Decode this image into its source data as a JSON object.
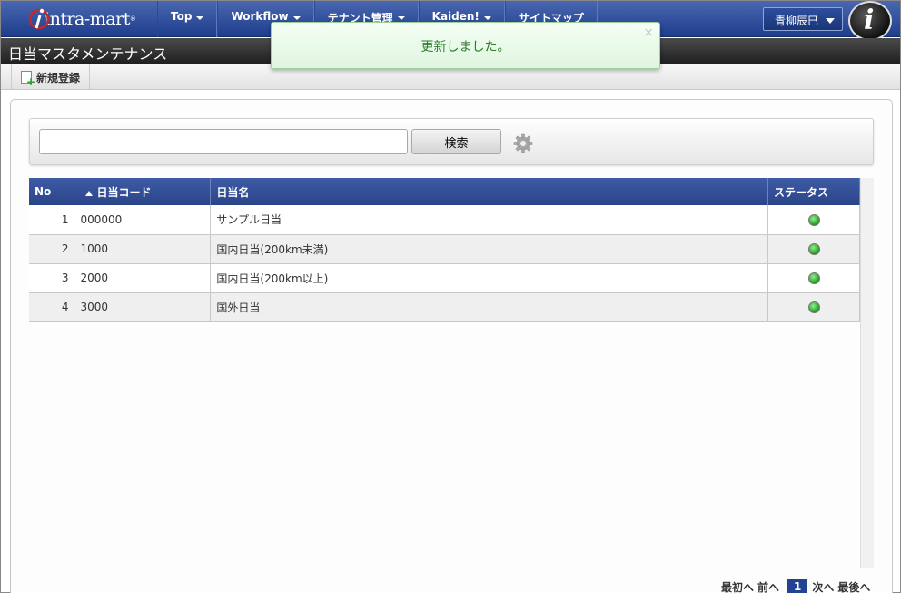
{
  "header": {
    "logo_text": "intra-mart",
    "logo_reg": "®",
    "nav": [
      {
        "label": "Top"
      },
      {
        "label": "Workflow"
      },
      {
        "label": "テナント管理"
      },
      {
        "label": "Kaiden!"
      },
      {
        "label": "サイトマップ"
      }
    ],
    "user_name": "青柳辰巳",
    "help_icon_letter": "i"
  },
  "page_title": "日当マスタメンテナンス",
  "toolbar": {
    "new_label": "新規登録"
  },
  "search": {
    "value": "",
    "placeholder": "",
    "button_label": "検索"
  },
  "table": {
    "columns": [
      "No",
      "日当コード",
      "日当名",
      "ステータス"
    ],
    "sort_indicator": "▲",
    "rows": [
      {
        "no": "1",
        "code": "000000",
        "name": "サンプル日当",
        "status": "active"
      },
      {
        "no": "2",
        "code": "1000",
        "name": "国内日当(200km未満)",
        "status": "active"
      },
      {
        "no": "3",
        "code": "2000",
        "name": "国内日当(200km以上)",
        "status": "active"
      },
      {
        "no": "4",
        "code": "3000",
        "name": "国外日当",
        "status": "active"
      }
    ]
  },
  "pager": {
    "first": "最初へ",
    "prev": "前へ",
    "current": "1",
    "next": "次へ",
    "last": "最後へ"
  },
  "toast": {
    "message": "更新しました。",
    "close": "×"
  },
  "colors": {
    "nav": "#2a4a9a",
    "table_header": "#2f4c94",
    "status_active": "#3cb33c",
    "toast_text": "#2c7a2c"
  }
}
